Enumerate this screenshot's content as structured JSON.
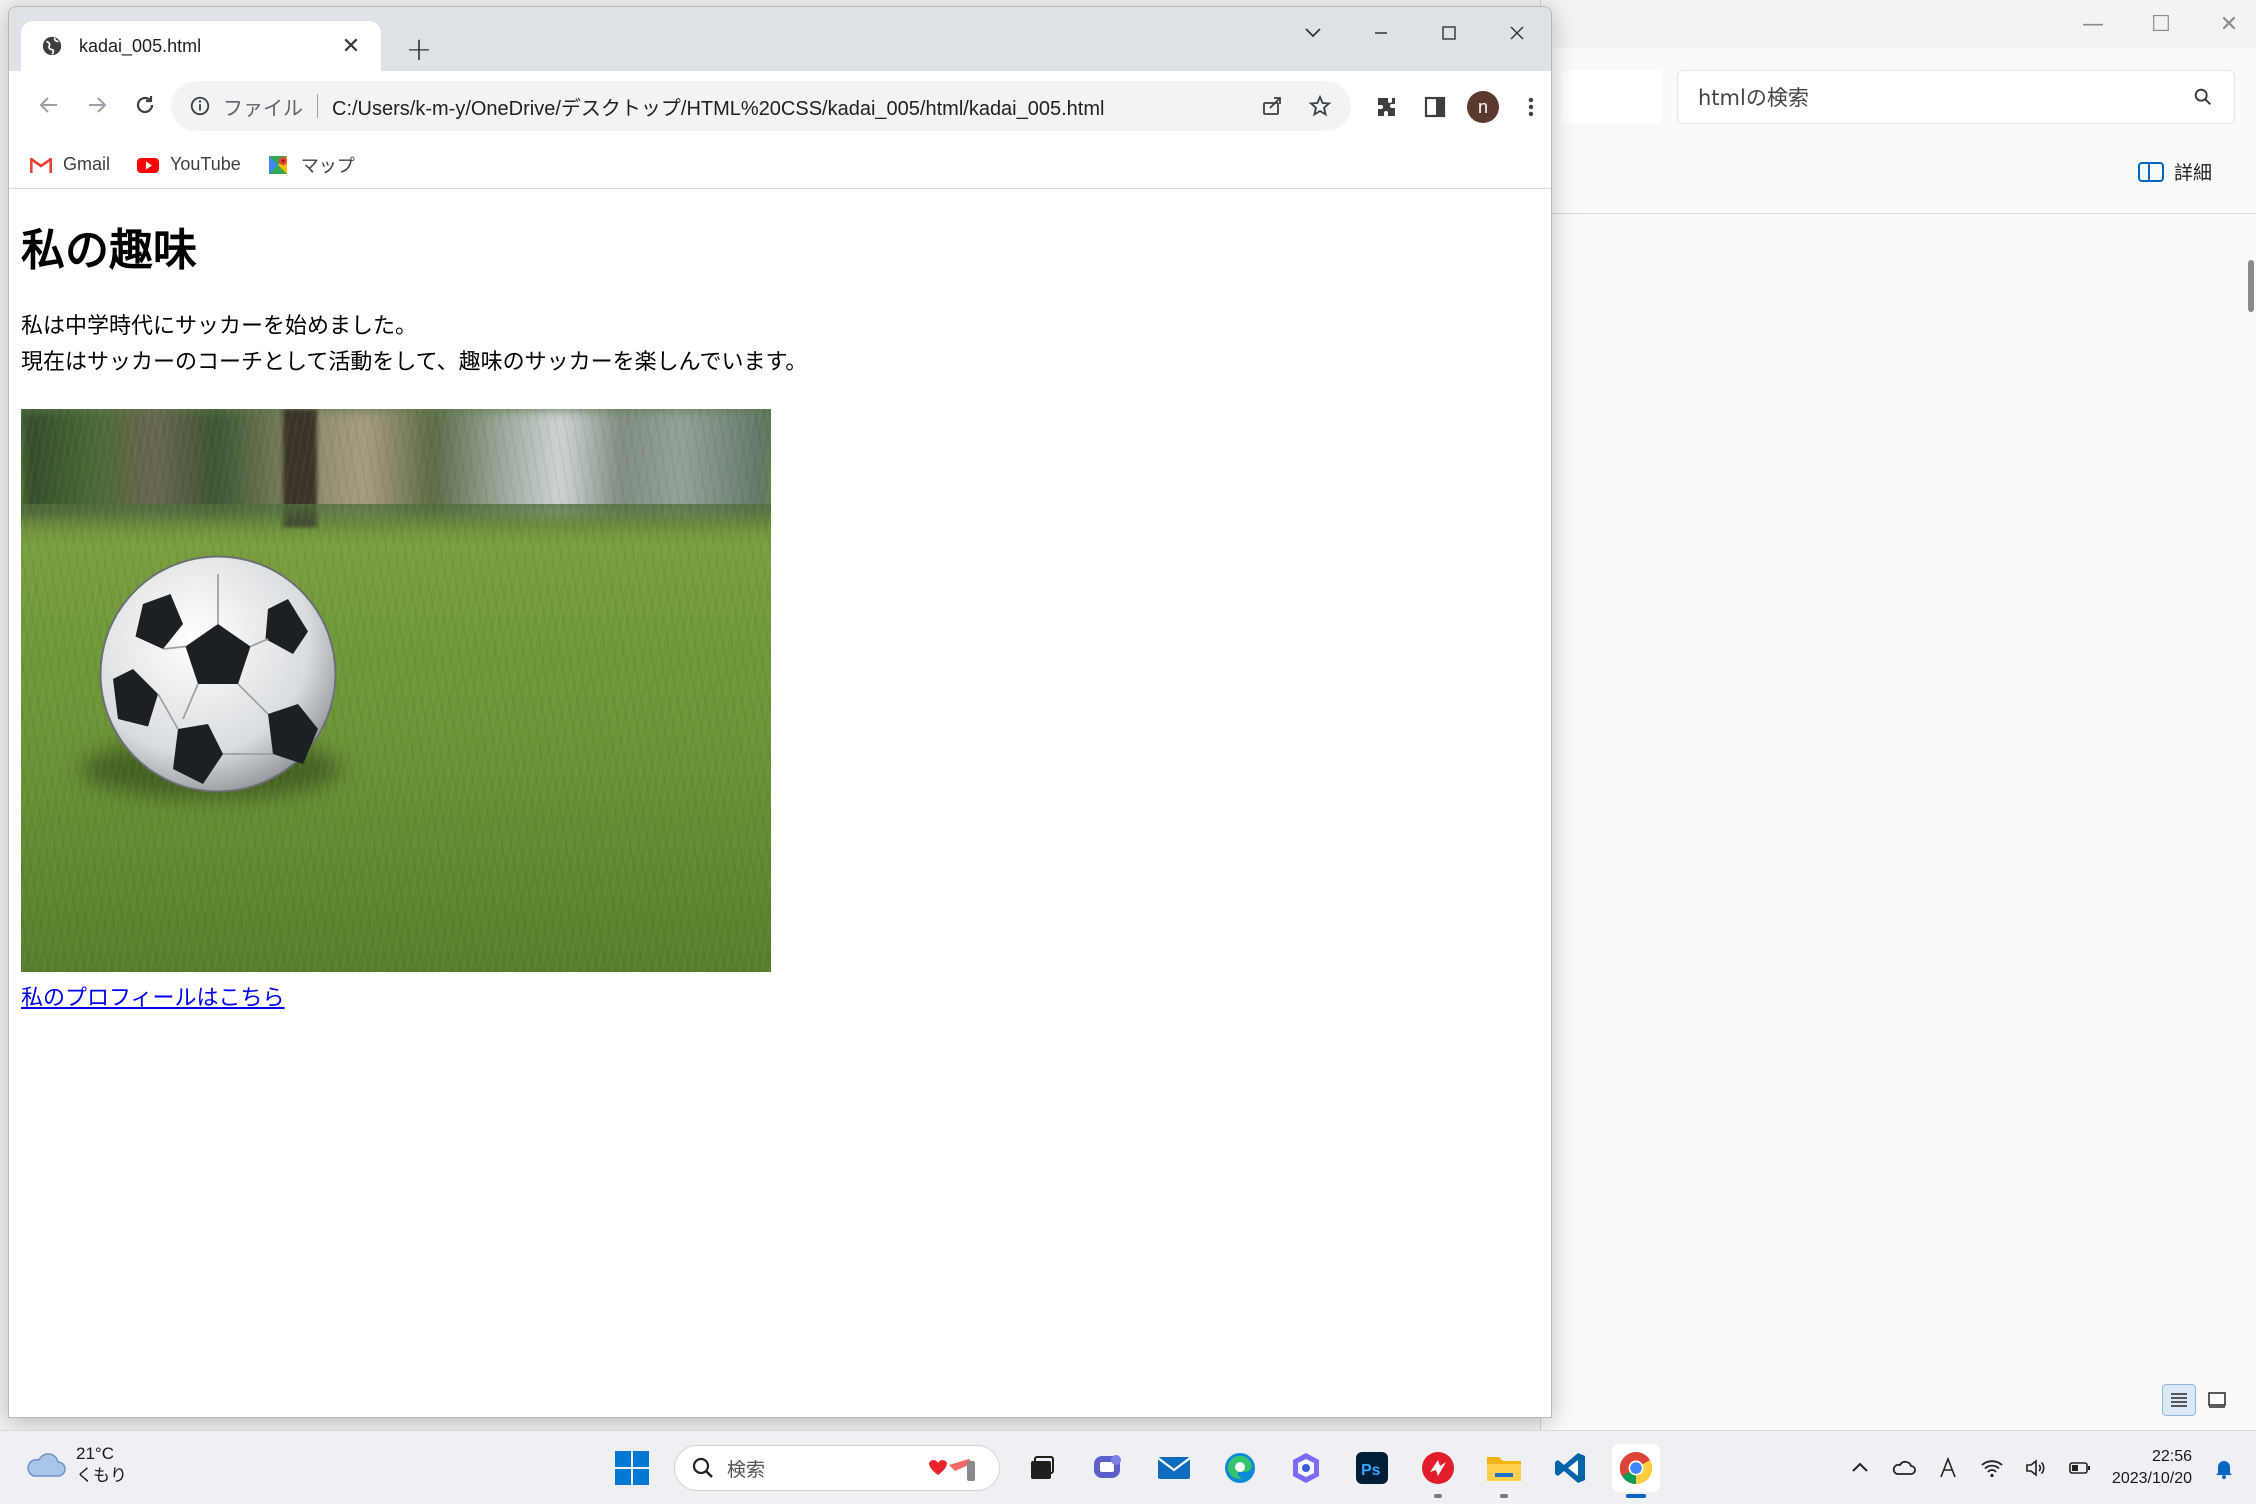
{
  "explorer": {
    "search_placeholder": "htmlの検索",
    "details_label": "詳細"
  },
  "chrome": {
    "tab_title": "kadai_005.html",
    "omnibox": {
      "scheme_label": "ファイル",
      "url": "C:/Users/k-m-y/OneDrive/デスクトップ/HTML%20CSS/kadai_005/html/kadai_005.html"
    },
    "profile_initial": "n",
    "bookmarks": [
      {
        "label": "Gmail",
        "icon": "gmail-icon"
      },
      {
        "label": "YouTube",
        "icon": "youtube-icon"
      },
      {
        "label": "マップ",
        "icon": "maps-icon"
      }
    ]
  },
  "page": {
    "heading": "私の趣味",
    "paragraph_line1": "私は中学時代にサッカーを始めました。",
    "paragraph_line2": "現在はサッカーのコーチとして活動をして、趣味のサッカーを楽しんでいます。",
    "image_subject": "soccer ball on grass",
    "link_text": "私のプロフィールはこちら"
  },
  "taskbar": {
    "weather": {
      "temp": "21°C",
      "condition": "くもり"
    },
    "search_placeholder": "検索",
    "apps": [
      "explorer-task",
      "teams",
      "mail",
      "edge",
      "copilot",
      "photoshop",
      "app-red",
      "file-explorer",
      "vscode",
      "chrome"
    ],
    "clock": {
      "time": "22:56",
      "date": "2023/10/20"
    }
  },
  "colors": {
    "link": "#0000ee",
    "chrome_tabstrip": "#dee1e6",
    "omnibox_bg": "#f1f3f4",
    "taskbar_bg": "#eef0f4",
    "active_indicator": "#0067c0"
  }
}
